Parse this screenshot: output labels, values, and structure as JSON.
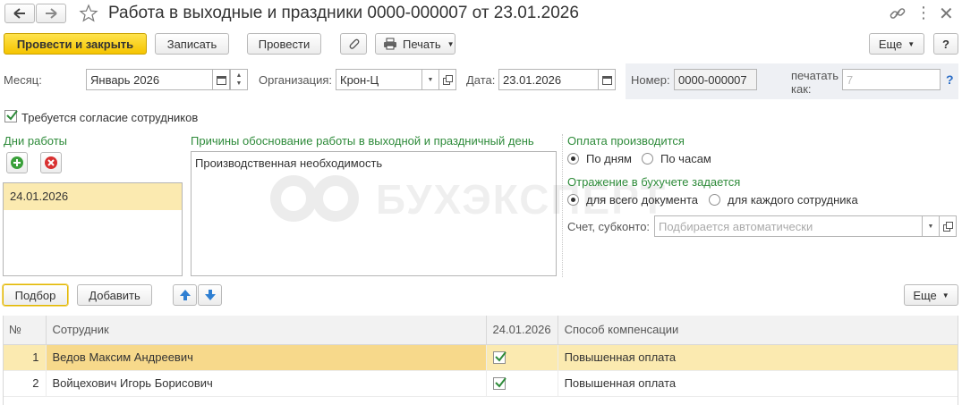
{
  "window": {
    "title": "Работа в выходные и праздники 0000-000007 от 23.01.2026"
  },
  "toolbar": {
    "post_close_label": "Провести и закрыть",
    "save_label": "Записать",
    "post_label": "Провести",
    "print_label": "Печать",
    "more_label": "Еще",
    "help_label": "?"
  },
  "header": {
    "month_label": "Месяц:",
    "month_value": "Январь 2026",
    "org_label": "Организация:",
    "org_value": "Крон-Ц",
    "date_label": "Дата:",
    "date_value": "23.01.2026",
    "number_label": "Номер:",
    "number_value": "0000-000007",
    "print_as_label_1": "печатать",
    "print_as_label_2": "как:",
    "print_as_placeholder": "7",
    "help_q": "?"
  },
  "consent": {
    "label": "Требуется согласие сотрудников",
    "checked": true
  },
  "work_days": {
    "title": "Дни работы",
    "items": [
      "24.01.2026"
    ]
  },
  "reasons": {
    "title": "Причины обоснование работы в выходной и праздничный день",
    "text": "Производственная необходимость"
  },
  "payment": {
    "title": "Оплата производится",
    "option_days": "По дням",
    "option_hours": "По часам",
    "selected": "days"
  },
  "accounting": {
    "title": "Отражение в бухучете задается",
    "option_document": "для всего документа",
    "option_employee": "для каждого сотрудника",
    "selected": "document",
    "account_label": "Счет, субконто:",
    "account_placeholder": "Подбирается автоматически"
  },
  "table_toolbar": {
    "pick_label": "Подбор",
    "add_label": "Добавить",
    "more_label": "Еще"
  },
  "table": {
    "columns": [
      "№",
      "Сотрудник",
      "24.01.2026",
      "Способ компенсации"
    ],
    "rows": [
      {
        "num": "1",
        "employee": "Ведов Максим Андреевич",
        "checked": true,
        "compensation": "Повышенная оплата"
      },
      {
        "num": "2",
        "employee": "Войцехович Игорь Борисович",
        "checked": true,
        "compensation": "Повышенная оплата"
      }
    ]
  },
  "watermark": "БУХЭКСПЕРТ",
  "colors": {
    "accent_yellow": "#f5c400",
    "group_title_green": "#2e8b3a",
    "selected_row": "#fbeab0"
  }
}
